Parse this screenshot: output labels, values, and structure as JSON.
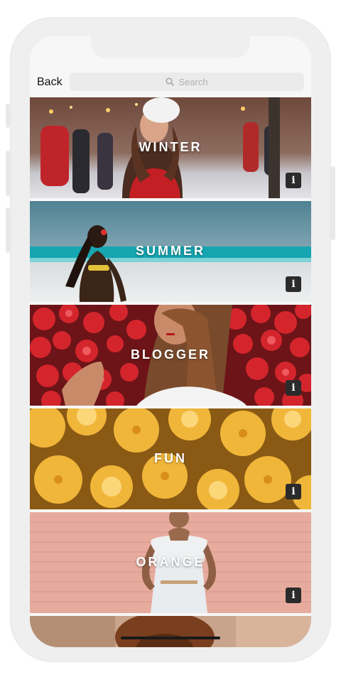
{
  "navbar": {
    "back_label": "Back",
    "search_placeholder": "Search"
  },
  "cards": [
    {
      "label": "WINTER",
      "info_label": "i"
    },
    {
      "label": "SUMMER",
      "info_label": "i"
    },
    {
      "label": "BLOGGER",
      "info_label": "i"
    },
    {
      "label": "FUN",
      "info_label": "i"
    },
    {
      "label": "ORANGE",
      "info_label": "i"
    },
    {
      "label": "",
      "info_label": ""
    }
  ],
  "icons": {
    "search": "search-icon",
    "info": "info-icon"
  },
  "colors": {
    "screen_background": "#f7f7f7",
    "info_button": "#2b2b2b",
    "label_text": "#ffffff"
  }
}
